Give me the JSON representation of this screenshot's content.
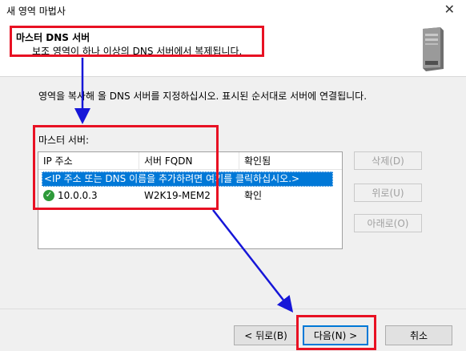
{
  "window": {
    "title": "새 영역 마법사",
    "close_glyph": "✕"
  },
  "header": {
    "title": "마스터 DNS 서버",
    "subtitle": "보조 영역이 하나 이상의 DNS 서버에서 복제됩니다."
  },
  "body": {
    "instruction": "영역을 복사해 올 DNS 서버를 지정하십시오. 표시된 순서대로 서버에 연결됩니다.",
    "list_label": "마스터 서버:",
    "columns": [
      "IP 주소",
      "서버 FQDN",
      "확인됨"
    ],
    "edit_placeholder": "<IP 주소 또는 DNS 이름을 추가하려면 여기를 클릭하십시오.>",
    "rows": [
      {
        "ip": "10.0.0.3",
        "fqdn": "W2K19-MEM2",
        "validated": "확인",
        "status_icon": "check-icon"
      }
    ]
  },
  "side_buttons": {
    "delete": "삭제(D)",
    "up": "위로(U)",
    "down": "아래로(O)"
  },
  "footer": {
    "back": "< 뒤로(B)",
    "next": "다음(N) >",
    "cancel": "취소"
  },
  "colors": {
    "annotation": "#e81123",
    "arrow": "#1616d8",
    "selection": "#0078d7"
  }
}
